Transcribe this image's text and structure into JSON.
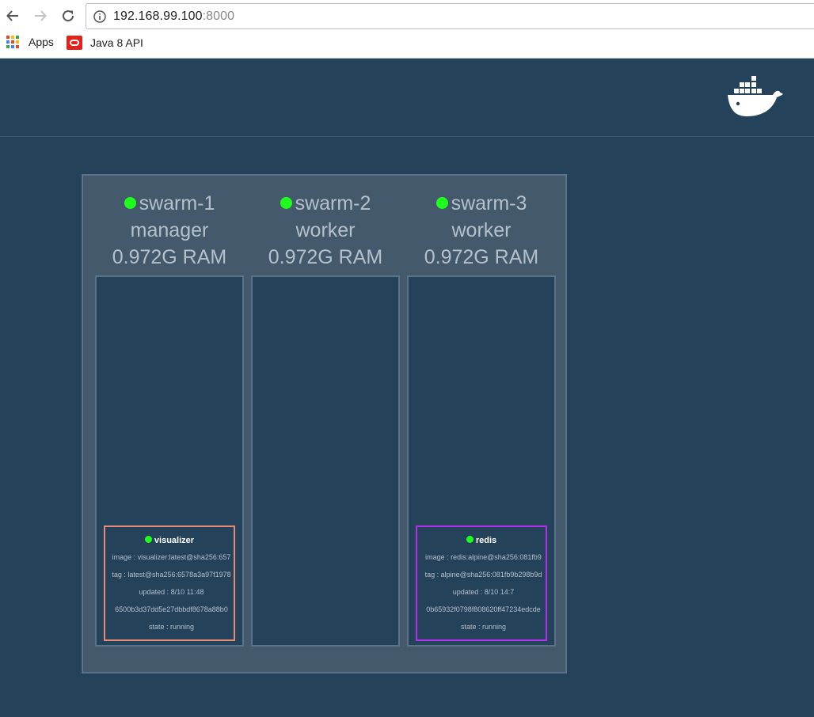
{
  "browser": {
    "url_host": "192.168.99.100",
    "url_port": ":8000",
    "bookmarks": [
      {
        "label": "Apps"
      },
      {
        "label": "Java 8 API"
      }
    ]
  },
  "colors": {
    "background": "#24425a",
    "panel": "#445a6c",
    "status_green": "#1eff1e",
    "visualizer_border": "#e58a79",
    "redis_border": "#b52ff0"
  },
  "nodes": [
    {
      "name": "swarm-1",
      "role": "manager",
      "ram": "0.972G RAM",
      "task": {
        "name": "visualizer",
        "image": "image : visualizer:latest@sha256:657",
        "tag": "tag : latest@sha256:6578a3a97f1978",
        "updated": "updated : 8/10 11:48",
        "id": "6500b3d37dd5e27dbbdf8678a88b0",
        "state": "state : running"
      }
    },
    {
      "name": "swarm-2",
      "role": "worker",
      "ram": "0.972G RAM"
    },
    {
      "name": "swarm-3",
      "role": "worker",
      "ram": "0.972G RAM",
      "task": {
        "name": "redis",
        "image": "image : redis:alpine@sha256:081fb9",
        "tag": "tag : alpine@sha256:081fb9b298b9d",
        "updated": "updated : 8/10 14:7",
        "id": "0b65932f0798f808620ff47234edcde",
        "state": "state : running"
      }
    }
  ]
}
